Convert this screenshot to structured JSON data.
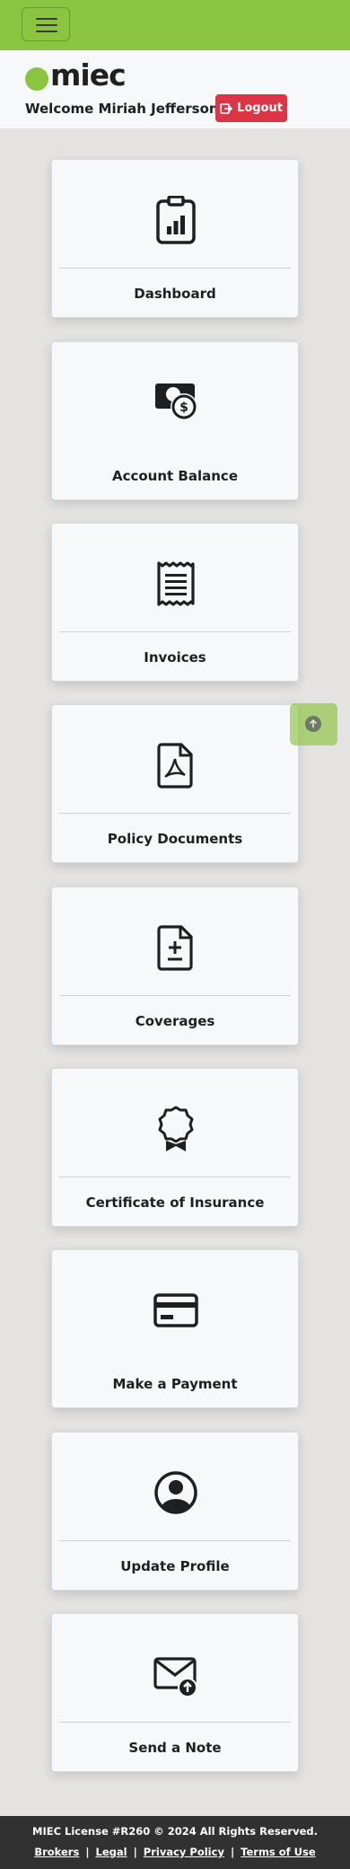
{
  "nav": {
    "menu_icon": "hamburger-icon"
  },
  "header": {
    "logo_text": "miec",
    "welcome": "Welcome Miriah Jefferson",
    "logout_label": "Logout",
    "logout_icon": "logout-icon"
  },
  "cards": [
    {
      "label": "Dashboard",
      "icon": "clipboard-chart-icon"
    },
    {
      "label": "Account Balance",
      "icon": "cash-coin-icon"
    },
    {
      "label": "Invoices",
      "icon": "receipt-icon"
    },
    {
      "label": "Policy Documents",
      "icon": "pdf-file-icon"
    },
    {
      "label": "Coverages",
      "icon": "file-plus-minus-icon"
    },
    {
      "label": "Certificate of Insurance",
      "icon": "award-icon"
    },
    {
      "label": "Make a Payment",
      "icon": "credit-card-icon"
    },
    {
      "label": "Update Profile",
      "icon": "person-circle-icon"
    },
    {
      "label": "Send a Note",
      "icon": "envelope-upload-icon"
    }
  ],
  "scroll_top": {
    "icon": "arrow-up-circle-icon"
  },
  "footer": {
    "copyright": "MIEC License #R260 © 2024 All Rights Reserved.",
    "links": [
      "Brokers",
      "Legal",
      "Privacy Policy",
      "Terms of Use"
    ]
  },
  "colors": {
    "brand_green": "#8bc53f",
    "logout_red": "#dc3545",
    "footer_bg": "#313131"
  }
}
